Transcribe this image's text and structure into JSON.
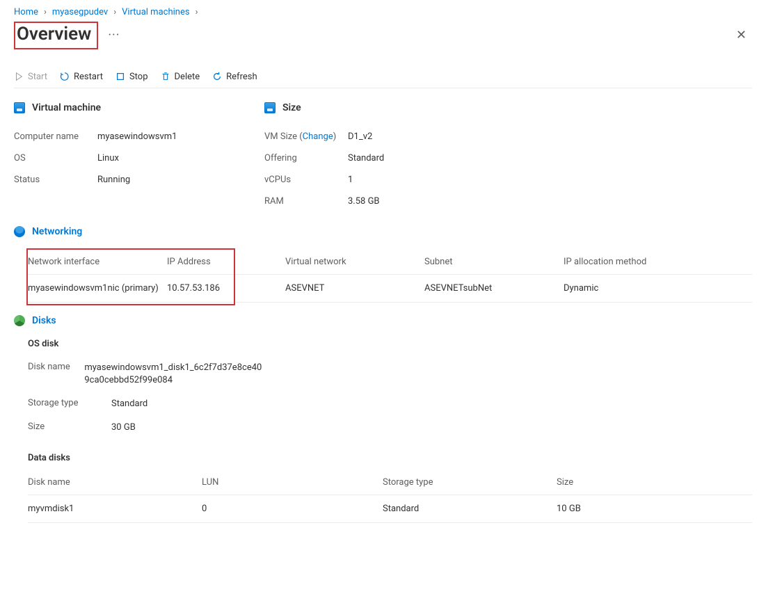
{
  "breadcrumb": {
    "home": "Home",
    "resource": "myasegpudev",
    "vms": "Virtual machines"
  },
  "page": {
    "title": "Overview"
  },
  "toolbar": {
    "start": "Start",
    "restart": "Restart",
    "stop": "Stop",
    "delete": "Delete",
    "refresh": "Refresh"
  },
  "vm": {
    "heading": "Virtual machine",
    "labels": {
      "computer_name": "Computer name",
      "os": "OS",
      "status": "Status"
    },
    "computer_name": "myasewindowsvm1",
    "os": "Linux",
    "status": "Running"
  },
  "size": {
    "heading": "Size",
    "labels": {
      "vm_size": "VM Size",
      "change": "Change",
      "offering": "Offering",
      "vcpus": "vCPUs",
      "ram": "RAM"
    },
    "vm_size": "D1_v2",
    "offering": "Standard",
    "vcpus": "1",
    "ram": "3.58 GB"
  },
  "networking": {
    "heading": "Networking",
    "headers": {
      "nic": "Network interface",
      "ip": "IP Address",
      "vnet": "Virtual network",
      "subnet": "Subnet",
      "alloc": "IP allocation method"
    },
    "row": {
      "nic": "myasewindowsvm1nic (primary)",
      "ip": "10.57.53.186",
      "vnet": "ASEVNET",
      "subnet": "ASEVNETsubNet",
      "alloc": "Dynamic"
    }
  },
  "disks": {
    "heading": "Disks",
    "os_disk_heading": "OS disk",
    "labels": {
      "disk_name": "Disk name",
      "storage_type": "Storage type",
      "size": "Size"
    },
    "os_disk": {
      "disk_name": "myasewindowsvm1_disk1_6c2f7d37e8ce409ca0cebbd52f99e084",
      "storage_type": "Standard",
      "size": "30 GB"
    },
    "data_disks_heading": "Data disks",
    "data_headers": {
      "disk_name": "Disk name",
      "lun": "LUN",
      "storage_type": "Storage type",
      "size": "Size"
    },
    "data_row": {
      "disk_name": "myvmdisk1",
      "lun": "0",
      "storage_type": "Standard",
      "size": "10 GB"
    }
  }
}
